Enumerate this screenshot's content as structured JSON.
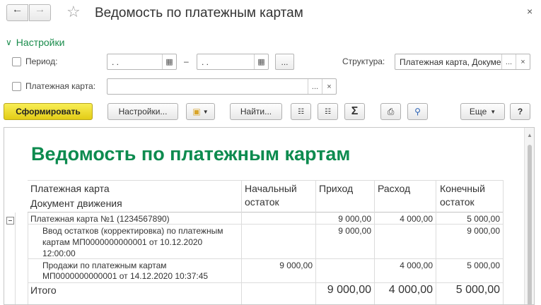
{
  "window": {
    "title": "Ведомость по платежным картам",
    "close": "×"
  },
  "settings": {
    "header": "Настройки",
    "period_label": "Период:",
    "period_from": " .  .",
    "period_to": " .  .",
    "dash": "–",
    "ellipsis": "...",
    "structure_label": "Структура:",
    "structure_value": "Платежная карта, Документ",
    "card_label": "Платежная карта:",
    "card_value": ""
  },
  "toolbar": {
    "generate": "Сформировать",
    "settings": "Настройки...",
    "find": "Найти...",
    "sum": "Σ",
    "more": "Еще",
    "help": "?"
  },
  "report": {
    "title": "Ведомость по платежным картам",
    "headers": {
      "card": "Платежная карта",
      "doc": "Документ движения",
      "opening": [
        "Начальный",
        "остаток"
      ],
      "income": "Приход",
      "expense": "Расход",
      "closing": [
        "Конечный",
        "остаток"
      ]
    },
    "rows": [
      {
        "name": [
          "Платежная карта №1 (1234567890)"
        ],
        "opening": "",
        "income": "9 000,00",
        "expense": "4 000,00",
        "closing": "5 000,00"
      },
      {
        "name": [
          "Ввод остатков (корректировка) по платежным",
          "картам МП0000000000001 от 10.12.2020",
          "12:00:00"
        ],
        "opening": "",
        "income": "9 000,00",
        "expense": "",
        "closing": "9 000,00"
      },
      {
        "name": [
          "Продажи по платежным картам",
          "МП0000000000001 от 14.12.2020 10:37:45"
        ],
        "opening": "9 000,00",
        "income": "",
        "expense": "4 000,00",
        "closing": "5 000,00"
      }
    ],
    "total": {
      "label": "Итого",
      "income": "9 000,00",
      "expense": "4 000,00",
      "closing": "5 000,00"
    }
  },
  "colors": {
    "accent": "#0d8b4f",
    "primary_button": "#ecd92a"
  }
}
